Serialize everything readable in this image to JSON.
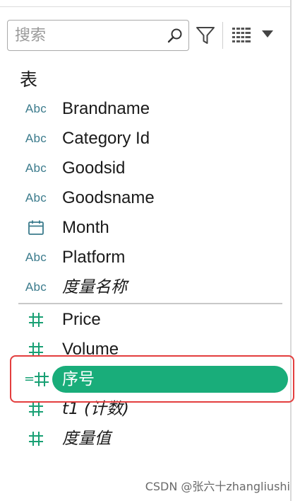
{
  "search": {
    "placeholder": "搜索",
    "value": ""
  },
  "section": {
    "title": "表"
  },
  "dimensions": [
    {
      "type_icon": "abc-icon",
      "type_text": "Abc",
      "label": "Brandname"
    },
    {
      "type_icon": "abc-icon",
      "type_text": "Abc",
      "label": "Category Id"
    },
    {
      "type_icon": "abc-icon",
      "type_text": "Abc",
      "label": "Goodsid"
    },
    {
      "type_icon": "abc-icon",
      "type_text": "Abc",
      "label": "Goodsname"
    },
    {
      "type_icon": "calendar-icon",
      "type_text": "",
      "label": "Month"
    },
    {
      "type_icon": "abc-icon",
      "type_text": "Abc",
      "label": "Platform"
    },
    {
      "type_icon": "abc-icon",
      "type_text": "Abc",
      "label": "度量名称"
    }
  ],
  "measures": [
    {
      "type_icon": "hash-icon",
      "label": "Price"
    },
    {
      "type_icon": "hash-icon",
      "label": "Volume"
    },
    {
      "type_icon": "calculated-hash-icon",
      "prefix": "=",
      "label": "序号",
      "selected": true
    },
    {
      "type_icon": "hash-icon",
      "label": "t1 (计数)"
    },
    {
      "type_icon": "hash-icon",
      "label": "度量值"
    }
  ],
  "colors": {
    "selected_pill": "#19ad7a",
    "highlight_border": "#e33e3e",
    "abc_icon": "#3b7b8c",
    "hash_icon": "#19a074"
  },
  "watermark": "CSDN @张六十zhangliushi"
}
